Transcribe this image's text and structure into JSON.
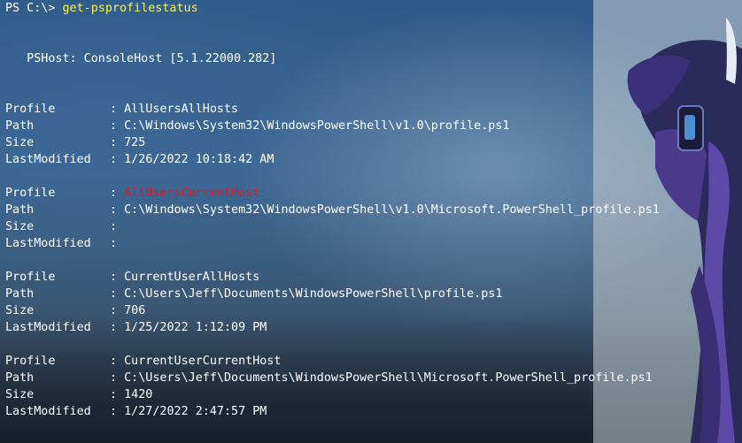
{
  "window": {
    "title": ""
  },
  "colors": {
    "background": "#2a4f78",
    "text": "#ffffff",
    "command": "#f9f15a",
    "error": "#e01b24"
  },
  "console": {
    "prompt": "PS C:\\> ",
    "command": "get-psprofilestatus",
    "pshost_line": "   PSHost: ConsoleHost [5.1.22000.282]",
    "labels": {
      "profile": "Profile",
      "path": "Path",
      "size": "Size",
      "lastmodified": "LastModified",
      "separator": ": "
    },
    "records": [
      {
        "profile": "AllUsersAllHosts",
        "path": "C:\\Windows\\System32\\WindowsPowerShell\\v1.0\\profile.ps1",
        "size": "725",
        "lastmodified": "1/26/2022 10:18:42 AM",
        "missing": false
      },
      {
        "profile": "AllUsersCurrentHost",
        "path": "C:\\Windows\\System32\\WindowsPowerShell\\v1.0\\Microsoft.PowerShell_profile.ps1",
        "size": "",
        "lastmodified": "",
        "missing": true
      },
      {
        "profile": "CurrentUserAllHosts",
        "path": "C:\\Users\\Jeff\\Documents\\WindowsPowerShell\\profile.ps1",
        "size": "706",
        "lastmodified": "1/25/2022 1:12:09 PM",
        "missing": false
      },
      {
        "profile": "CurrentUserCurrentHost",
        "path": "C:\\Users\\Jeff\\Documents\\WindowsPowerShell\\Microsoft.PowerShell_profile.ps1",
        "size": "1420",
        "lastmodified": "1/27/2022 2:47:57 PM",
        "missing": false
      }
    ]
  }
}
